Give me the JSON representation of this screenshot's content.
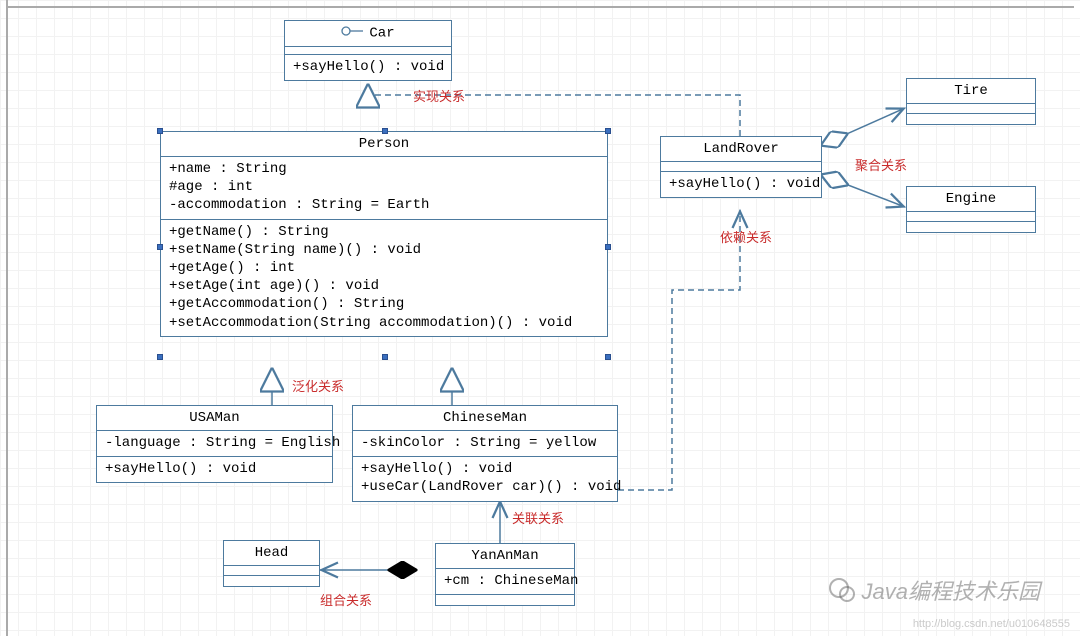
{
  "classes": {
    "car": {
      "name": "Car",
      "stereotype": "interface",
      "methods": "+sayHello() : void"
    },
    "person": {
      "name": "Person",
      "attrs": "+name : String\n#age : int\n-accommodation : String = Earth",
      "methods": "+getName() : String\n+setName(String name)() : void\n+getAge() : int\n+setAge(int age)() : void\n+getAccommodation() : String\n+setAccommodation(String accommodation)() : void"
    },
    "usaman": {
      "name": "USAMan",
      "attrs": "-language : String = English",
      "methods": "+sayHello() : void"
    },
    "chineseman": {
      "name": "ChineseMan",
      "attrs": "-skinColor : String = yellow",
      "methods": "+sayHello() : void\n+useCar(LandRover car)() : void"
    },
    "yananman": {
      "name": "YanAnMan",
      "attrs": "+cm : ChineseMan"
    },
    "head": {
      "name": "Head"
    },
    "landrover": {
      "name": "LandRover",
      "methods": "+sayHello() : void"
    },
    "tire": {
      "name": "Tire"
    },
    "engine": {
      "name": "Engine"
    }
  },
  "labels": {
    "realization": "实现关系",
    "generalization": "泛化关系",
    "association": "关联关系",
    "composition": "组合关系",
    "aggregation": "聚合关系",
    "dependency": "依赖关系"
  },
  "watermark": "Java编程技术乐园",
  "watermark_url": "http://blog.csdn.net/u010648555"
}
